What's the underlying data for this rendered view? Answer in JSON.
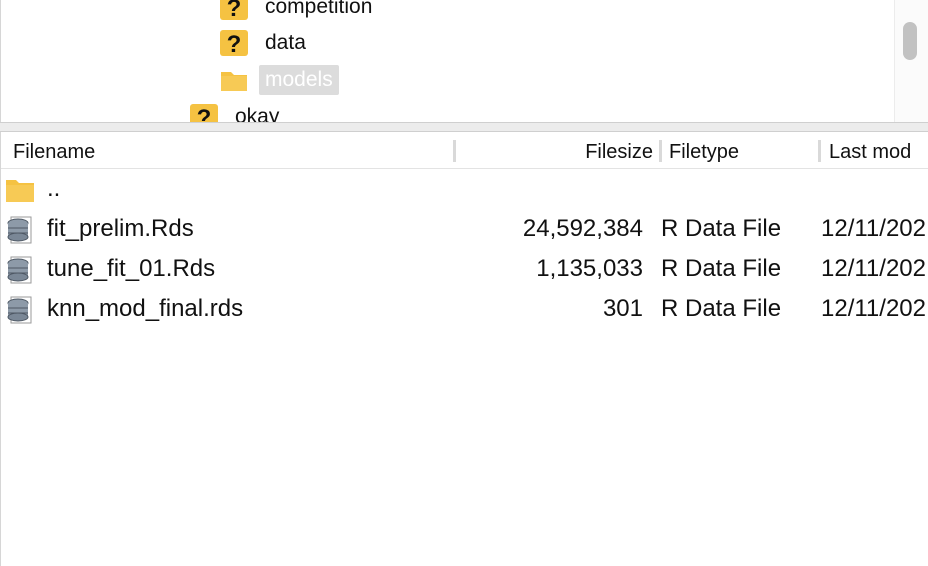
{
  "tree": {
    "items": [
      {
        "label": "competition",
        "icon": "unknown-folder-icon",
        "selected": false
      },
      {
        "label": "data",
        "icon": "unknown-folder-icon",
        "selected": false
      },
      {
        "label": "models",
        "icon": "folder-icon",
        "selected": true
      },
      {
        "label": "okay",
        "icon": "unknown-folder-icon",
        "selected": false
      }
    ]
  },
  "list": {
    "columns": {
      "filename": "Filename",
      "filesize": "Filesize",
      "filetype": "Filetype",
      "lastmod": "Last mod"
    },
    "rows": [
      {
        "name": "..",
        "size": "",
        "type": "",
        "modified": "",
        "icon": "folder-icon"
      },
      {
        "name": "fit_prelim.Rds",
        "size": "24,592,384",
        "type": "R Data File",
        "modified": "12/11/202",
        "icon": "r-data-file-icon"
      },
      {
        "name": "tune_fit_01.Rds",
        "size": "1,135,033",
        "type": "R Data File",
        "modified": "12/11/202",
        "icon": "r-data-file-icon"
      },
      {
        "name": "knn_mod_final.rds",
        "size": "301",
        "type": "R Data File",
        "modified": "12/11/202",
        "icon": "r-data-file-icon"
      }
    ]
  },
  "colors": {
    "folder": "#f5c242",
    "selection": "#dcdcdc",
    "scroll_thumb": "#c2c2c2"
  }
}
